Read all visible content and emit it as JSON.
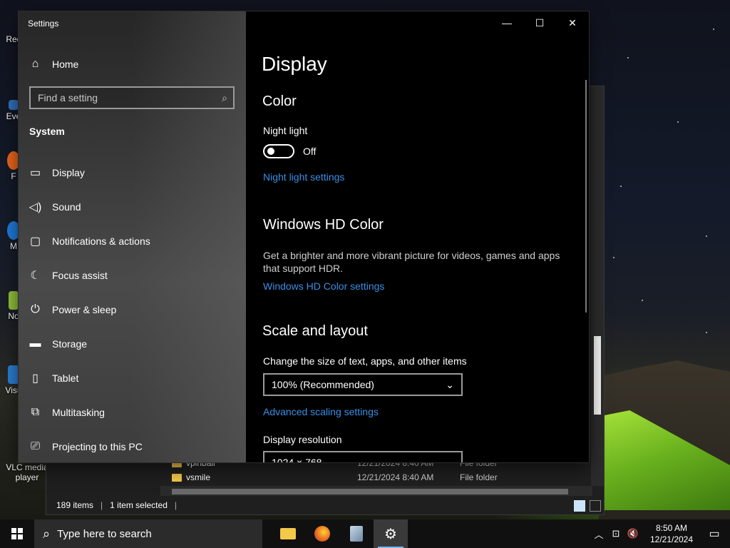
{
  "desktop": {
    "icons": [
      {
        "label": "Rec",
        "color": "#cfe4f5"
      },
      {
        "label": "Eve",
        "color": "#2f6fb8"
      },
      {
        "label": "F",
        "color": "#e8651a"
      },
      {
        "label": "M",
        "color": "#1f7ad9"
      },
      {
        "label": "No",
        "color": "#8fbf3a"
      },
      {
        "label": "Visu",
        "color": "#2a7dd1"
      },
      {
        "label": "VLC media player",
        "color": "#f08a1c"
      }
    ]
  },
  "explorer": {
    "rows": [
      {
        "name": "vpinball",
        "date": "12/21/2024 8:40 AM",
        "type": "File folder"
      },
      {
        "name": "vsmile",
        "date": "12/21/2024 8:40 AM",
        "type": "File folder"
      }
    ],
    "status": {
      "items_count": "189 items",
      "selected": "1 item selected"
    }
  },
  "settings": {
    "window_title": "Settings",
    "nav": {
      "home_label": "Home",
      "search_placeholder": "Find a setting",
      "section_label": "System",
      "items": [
        {
          "label": "Display",
          "icon": "monitor-icon",
          "glyph": "▭"
        },
        {
          "label": "Sound",
          "icon": "speaker-icon",
          "glyph": "🔈"
        },
        {
          "label": "Notifications & actions",
          "icon": "message-icon",
          "glyph": "▢"
        },
        {
          "label": "Focus assist",
          "icon": "moon-icon",
          "glyph": "☾"
        },
        {
          "label": "Power & sleep",
          "icon": "power-icon",
          "glyph": "⏻"
        },
        {
          "label": "Storage",
          "icon": "storage-icon",
          "glyph": "▬"
        },
        {
          "label": "Tablet",
          "icon": "tablet-icon",
          "glyph": "▯"
        },
        {
          "label": "Multitasking",
          "icon": "multitask-icon",
          "glyph": "⧉"
        },
        {
          "label": "Projecting to this PC",
          "icon": "projector-icon",
          "glyph": "⎚"
        }
      ]
    },
    "content": {
      "page_title": "Display",
      "color_heading": "Color",
      "night_light_label": "Night light",
      "night_light_state": "Off",
      "night_light_link": "Night light settings",
      "hd_heading": "Windows HD Color",
      "hd_description": "Get a brighter and more vibrant picture for videos, games and apps that support HDR.",
      "hd_link": "Windows HD Color settings",
      "scale_heading": "Scale and layout",
      "scale_label": "Change the size of text, apps, and other items",
      "scale_value": "100% (Recommended)",
      "advanced_link": "Advanced scaling settings",
      "resolution_label": "Display resolution",
      "resolution_value": "1024 × 768"
    }
  },
  "taskbar": {
    "search_placeholder": "Type here to search",
    "apps": [
      {
        "name": "file-explorer-icon",
        "color": "#f3c94a"
      },
      {
        "name": "firefox-icon",
        "color": "#e8651a"
      },
      {
        "name": "app-stack-icon",
        "color": "#9ab0c8"
      },
      {
        "name": "settings-gear-icon",
        "color": "#ffffff"
      }
    ],
    "clock_time": "8:50 AM",
    "clock_date": "12/21/2024"
  },
  "colors": {
    "accent_link": "#3a8ee6",
    "taskbar_indicator": "#76b9ed"
  }
}
